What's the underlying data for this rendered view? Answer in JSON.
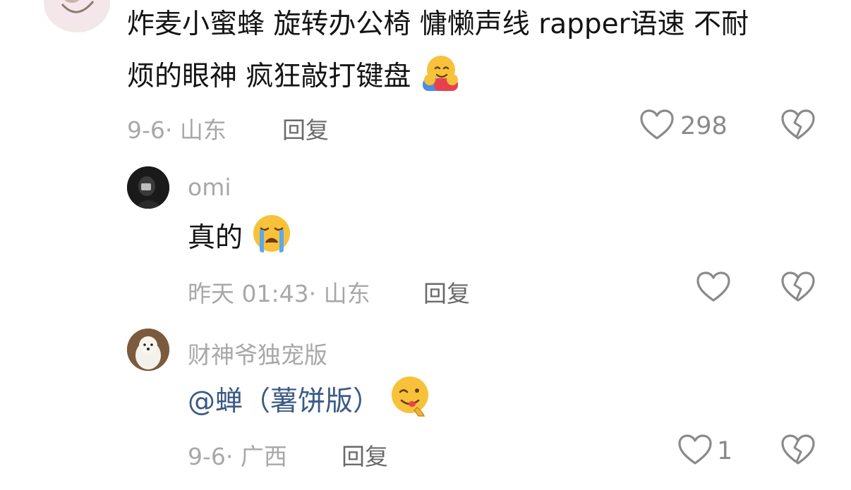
{
  "comments": [
    {
      "text_line1": "炸麦小蜜蜂 旋转办公椅 慵懒声线 rapper语速 不耐",
      "text_line2": "烦的眼神 疯狂敲打键盘",
      "emoji": "hugging-face-emoji",
      "meta": "9-6· 山东",
      "reply_label": "回复",
      "like_count": "298"
    },
    {
      "username": "omi",
      "text": "真的",
      "emoji": "loudly-crying-face-emoji",
      "meta": "昨天 01:43· 山东",
      "reply_label": "回复",
      "like_count": ""
    },
    {
      "username": "财神爷独宠版",
      "mention": "@蝉（薯饼版）",
      "emoji": "face-savoring-food-emoji",
      "meta": "9-6· 广西",
      "reply_label": "回复",
      "like_count": "1"
    }
  ],
  "icons": {
    "like": "heart-outline-icon",
    "dislike": "broken-heart-icon"
  }
}
